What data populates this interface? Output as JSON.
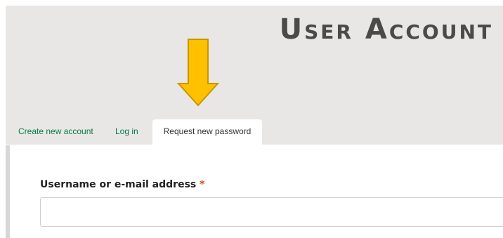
{
  "header": {
    "title": "User Account"
  },
  "tabs": [
    {
      "label": "Create new account",
      "active": false
    },
    {
      "label": "Log in",
      "active": false
    },
    {
      "label": "Request new password",
      "active": true
    }
  ],
  "form": {
    "username_label": "Username or e-mail address",
    "required_marker": "*",
    "username_value": ""
  },
  "colors": {
    "header_background": "#e9e7e6",
    "tab_link": "#0a7a4a",
    "required": "#d14a17",
    "arrow_fill": "#ffc000",
    "arrow_stroke": "#c89600"
  },
  "icons": {
    "annotation": "down-arrow-icon"
  }
}
